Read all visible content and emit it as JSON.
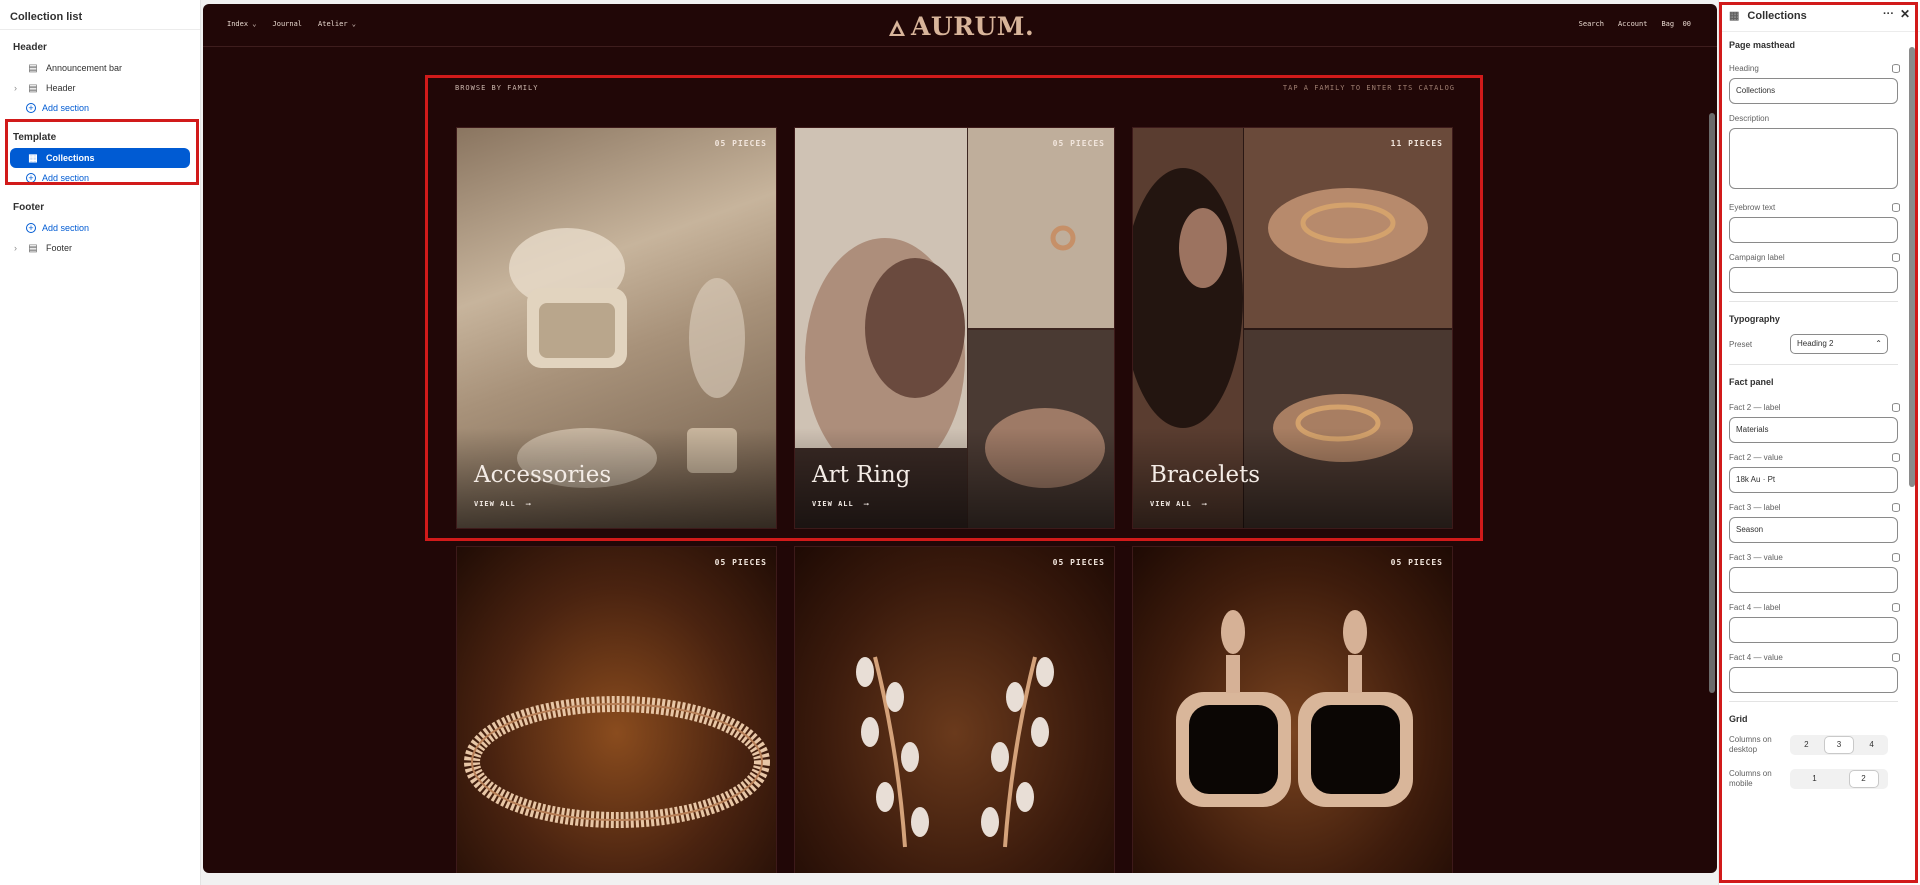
{
  "left": {
    "title": "Collection list",
    "header_group": "Header",
    "announcement": "Announcement bar",
    "header_item": "Header",
    "add_section": "Add section",
    "template_group": "Template",
    "collections_item": "Collections",
    "footer_group": "Footer",
    "footer_item": "Footer"
  },
  "store": {
    "nav_index": "Index",
    "nav_journal": "Journal",
    "nav_atelier": "Atelier",
    "logo": "AURUM.",
    "nav_search": "Search",
    "nav_account": "Account",
    "nav_bag": "Bag",
    "bag_count": "00",
    "browse": "BROWSE BY FAMILY",
    "tap": "TAP A FAMILY TO ENTER ITS CATALOG",
    "view_all": "VIEW ALL",
    "cards": [
      {
        "name": "Accessories",
        "count": "05 PIECES"
      },
      {
        "name": "Art Ring",
        "count": "05 PIECES"
      },
      {
        "name": "Bracelets",
        "count": "11 PIECES"
      },
      {
        "name": "",
        "count": "05 PIECES"
      },
      {
        "name": "",
        "count": "05 PIECES"
      },
      {
        "name": "",
        "count": "05 PIECES"
      }
    ]
  },
  "right": {
    "title": "Collections",
    "page_masthead": "Page masthead",
    "heading_label": "Heading",
    "heading_value": "Collections",
    "description_label": "Description",
    "eyebrow_label": "Eyebrow text",
    "campaign_label": "Campaign label",
    "typography": "Typography",
    "preset_label": "Preset",
    "preset_value": "Heading 2",
    "fact_panel": "Fact panel",
    "fact2_label_label": "Fact 2 — label",
    "fact2_label_value": "Materials",
    "fact2_value_label": "Fact 2 — value",
    "fact2_value_value": "18k Au · Pt",
    "fact3_label_label": "Fact 3 — label",
    "fact3_label_value": "Season",
    "fact3_value_label": "Fact 3 — value",
    "fact4_label_label": "Fact 4 — label",
    "fact4_value_label": "Fact 4 — value",
    "grid": "Grid",
    "cols_desktop_label": "Columns on desktop",
    "cols_desktop_options": [
      "2",
      "3",
      "4"
    ],
    "cols_desktop_selected": "3",
    "cols_mobile_label": "Columns on mobile",
    "cols_mobile_options": [
      "1",
      "2"
    ],
    "cols_mobile_selected": "2"
  }
}
